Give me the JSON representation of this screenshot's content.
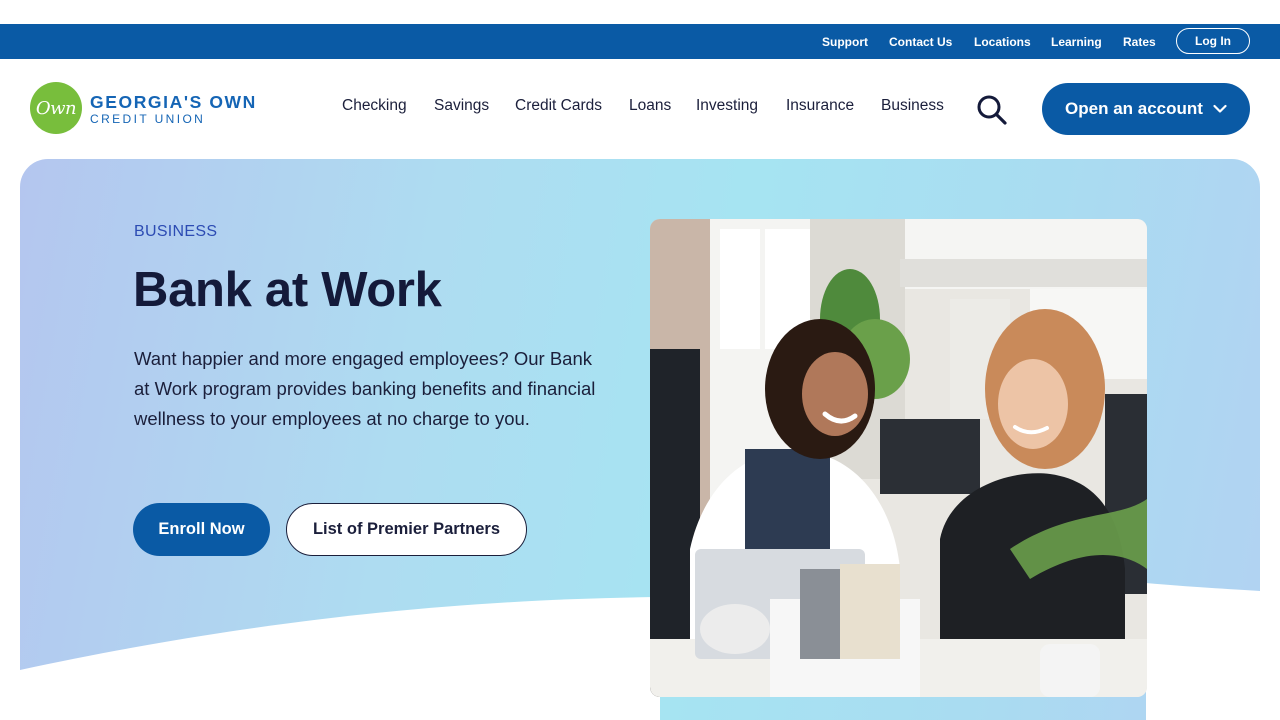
{
  "utility_nav": {
    "links": [
      "Support",
      "Contact Us",
      "Locations",
      "Learning",
      "Rates"
    ],
    "login_label": "Log In"
  },
  "brand": {
    "mark": "Own",
    "name": "GEORGIA'S OWN",
    "sub": "CREDIT UNION"
  },
  "main_nav": {
    "items": [
      "Checking",
      "Savings",
      "Credit Cards",
      "Loans",
      "Investing",
      "Insurance",
      "Business"
    ],
    "search_icon": "search-icon",
    "open_account_label": "Open an account"
  },
  "hero": {
    "eyebrow": "BUSINESS",
    "title": "Bank at Work",
    "body": "Want happier and more engaged employees? Our Bank at Work program provides banking benefits and financial wellness to your employees at no charge to you.",
    "primary_cta": "Enroll Now",
    "secondary_cta": "List of Premier Partners",
    "image_subject": "two smiling coworkers at desks in a bright office"
  },
  "colors": {
    "brand_blue": "#0a5aa5",
    "logo_green": "#78be3c",
    "eyebrow_blue": "#2c4bb3",
    "heading_navy": "#141a3a"
  }
}
